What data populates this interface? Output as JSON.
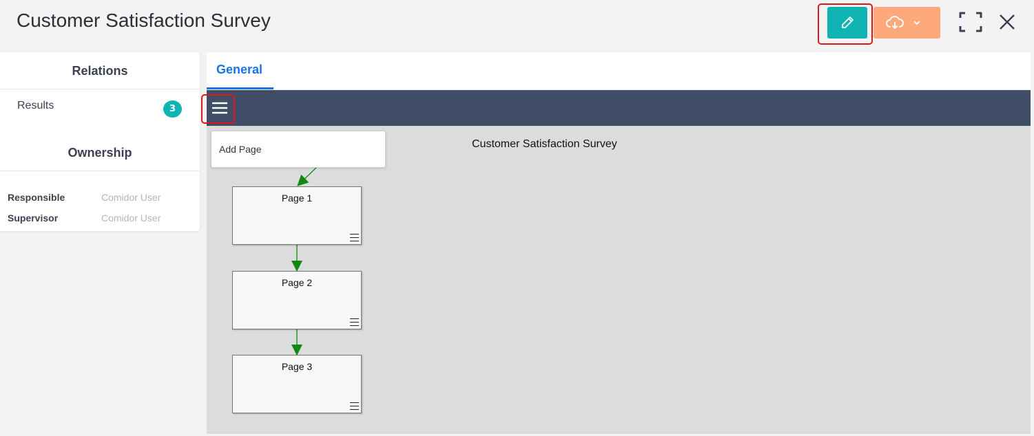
{
  "header": {
    "title": "Customer Satisfaction Survey",
    "edit_icon": "pencil-icon",
    "download_icon": "cloud-download-icon",
    "expand_icon": "fullscreen-icon",
    "close_icon": "close-icon"
  },
  "sidebar": {
    "relations_title": "Relations",
    "relations": [
      {
        "label": "Results",
        "count": "3"
      }
    ],
    "ownership_title": "Ownership",
    "ownership": [
      {
        "label": "Responsible",
        "value": "Comidor User"
      },
      {
        "label": "Supervisor",
        "value": "Comidor User"
      }
    ]
  },
  "main": {
    "tabs": [
      {
        "label": "General",
        "active": true
      }
    ],
    "menu": {
      "items": [
        {
          "label": "Add Page"
        }
      ]
    },
    "flow": {
      "root": "Customer Satisfaction Survey",
      "pages": [
        {
          "label": "Page 1"
        },
        {
          "label": "Page 2"
        },
        {
          "label": "Page 3"
        }
      ]
    }
  },
  "colors": {
    "accent": "#10b3b3",
    "download": "#fda97b",
    "toolbar": "#3f4d67",
    "tab_active": "#1a73e8",
    "highlight": "#e0161f",
    "arrow": "#118811"
  }
}
